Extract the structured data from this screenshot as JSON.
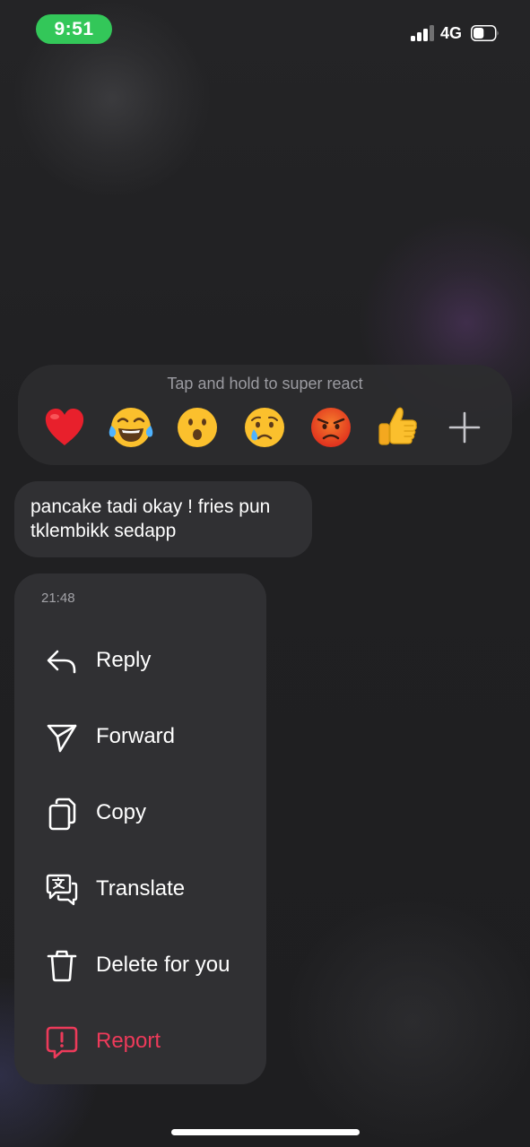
{
  "status_bar": {
    "time": "9:51",
    "network": "4G",
    "signal_bars_active": 3,
    "battery_level": 0.5,
    "time_pill_color": "#33c759"
  },
  "reaction_bar": {
    "hint": "Tap and hold to super react",
    "reactions": [
      {
        "name": "red-heart",
        "glyph": "❤️"
      },
      {
        "name": "face-with-tears-of-joy",
        "glyph": "😂"
      },
      {
        "name": "face-with-open-mouth",
        "glyph": "😮"
      },
      {
        "name": "crying-face",
        "glyph": "😢"
      },
      {
        "name": "angry-face",
        "glyph": "😡"
      },
      {
        "name": "thumbs-up",
        "glyph": "👍"
      }
    ],
    "more_icon": "plus-icon"
  },
  "message": {
    "text": "pancake tadi okay ! fries pun tklembikk sedapp"
  },
  "context_menu": {
    "timestamp": "21:48",
    "items": [
      {
        "id": "reply",
        "label": "Reply",
        "icon": "reply-icon"
      },
      {
        "id": "forward",
        "label": "Forward",
        "icon": "send-icon"
      },
      {
        "id": "copy",
        "label": "Copy",
        "icon": "copy-icon"
      },
      {
        "id": "translate",
        "label": "Translate",
        "icon": "translate-icon"
      },
      {
        "id": "delete",
        "label": "Delete for you",
        "icon": "trash-icon"
      },
      {
        "id": "report",
        "label": "Report",
        "icon": "report-icon"
      }
    ]
  },
  "colors": {
    "background": "#1f1f21",
    "surface": "#303033",
    "report_accent": "#ed3a5a",
    "secondary_text": "#a3a3a8"
  }
}
